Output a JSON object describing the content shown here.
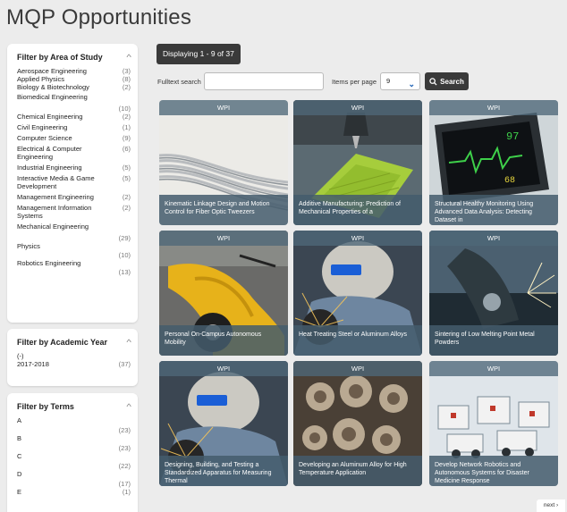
{
  "page": {
    "title": "MQP Opportunities"
  },
  "filters": {
    "area_of_study": {
      "title": "Filter by Area of Study",
      "items": [
        {
          "label": "Aerospace Engineering",
          "count": "(3)"
        },
        {
          "label": "Applied Physics",
          "count": "(8)"
        },
        {
          "label": "Biology & Biotechnology",
          "count": "(2)"
        },
        {
          "label": "Biomedical Engineering",
          "count": "(10)"
        },
        {
          "label": "Chemical Engineering",
          "count": "(2)"
        },
        {
          "label": "Civil Engineering",
          "count": "(1)"
        },
        {
          "label": "Computer Science",
          "count": "(9)"
        },
        {
          "label": "Electrical & Computer Engineering",
          "count": "(6)"
        },
        {
          "label": "Industrial Engineering",
          "count": "(5)"
        },
        {
          "label": "Interactive Media & Game Development",
          "count": "(5)"
        },
        {
          "label": "Management Engineering",
          "count": "(2)"
        },
        {
          "label": "Management Information Systems",
          "count": "(2)"
        },
        {
          "label": "Mechanical Engineering",
          "count": "(29)"
        },
        {
          "label": "Physics",
          "count": "(10)"
        },
        {
          "label": "Robotics Engineering",
          "count": "(13)"
        }
      ]
    },
    "academic_year": {
      "title": "Filter by Academic Year",
      "items": [
        {
          "label": "(-)",
          "count": ""
        },
        {
          "label": "2017-2018",
          "count": "(37)"
        }
      ]
    },
    "terms": {
      "title": "Filter by Terms",
      "items": [
        {
          "label": "A",
          "count": "(23)"
        },
        {
          "label": "B",
          "count": "(23)"
        },
        {
          "label": "C",
          "count": "(22)"
        },
        {
          "label": "D",
          "count": "(17)"
        },
        {
          "label": "E",
          "count": "(1)"
        }
      ]
    }
  },
  "results": {
    "displaying": "Displaying 1 - 9 of 37",
    "fulltext_label": "Fulltext search",
    "fulltext_value": "",
    "items_per_page_label": "Items per page",
    "items_per_page_value": "9",
    "search_label": "Search",
    "next_label": "next ›"
  },
  "cards": [
    {
      "badge": "WPI",
      "title": "Kinematic Linkage Design and Motion Control for Fiber Optic Tweezers",
      "image": "fiber-optic-cables"
    },
    {
      "badge": "WPI",
      "title": "Additive Manufacturing: Prediction of Mechanical Properties of a",
      "image": "3d-printer"
    },
    {
      "badge": "WPI",
      "title": "Structural Healthy Monitoring Using Advanced Data Analysis: Detecting Dataset in",
      "image": "heart-monitor"
    },
    {
      "badge": "WPI",
      "title": "Personal On-Campus Autonomous Mobility",
      "image": "yellow-scooter"
    },
    {
      "badge": "WPI",
      "title": "Heat Treating Steel or Aluminum Alloys",
      "image": "welder"
    },
    {
      "badge": "WPI",
      "title": "Sintering of Low Melting Point Metal Powders",
      "image": "metal-sparks"
    },
    {
      "badge": "WPI",
      "title": "Designing, Building, and Testing a Standardized Apparatus for Measuring Thermal",
      "image": "welder"
    },
    {
      "badge": "WPI",
      "title": "Developing an Aluminum Alloy for High Temperature Application",
      "image": "engine-parts"
    },
    {
      "badge": "WPI",
      "title": "Develop Network Robotics and Autonomous Systems for Disaster Medicine Response",
      "image": "lego-robots"
    }
  ]
}
